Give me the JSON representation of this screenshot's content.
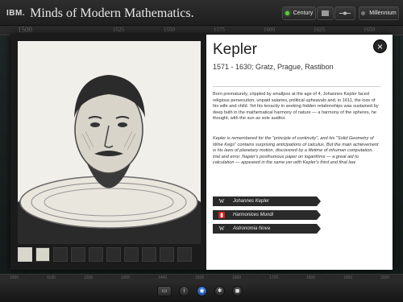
{
  "header": {
    "logo": "IBM.",
    "title": "Minds of Modern Mathematics.",
    "century_label": "Century",
    "millennium_label": "Millennium"
  },
  "timeline_top": [
    "1500",
    "1525",
    "1550",
    "1575",
    "1600",
    "1625",
    "1650"
  ],
  "timeline_bottom": [
    "1000",
    "1100",
    "1200",
    "1300",
    "1400",
    "1500",
    "1600",
    "1700",
    "1800",
    "1900",
    "2000"
  ],
  "detail": {
    "name": "Kepler",
    "dates": "1571 - 1630; Gratz, Prague, Rastibon",
    "bio": "Born prematurely, crippled by smallpox at the age of 4, Johannes Kepler faced religious persecution, unpaid salaries, political upheavals and, in 1611, the loss of his wife and child. Yet his tenacity in seeking hidden relationships was sustained by deep faith in the mathematical harmony of nature — a harmony of the spheres, he thought, with the sun as sole auditor.",
    "legacy": "Kepler is remembered for the \"principle of continuity\", and his \"Solid Geometry of Wine Kegs\" contains surprising anticipations of calculus. But the main achievement is his laws of planetary motion, discovered by a lifetime of inhuman computation, trial and error. Napier's posthumous paper on logarithms — a great aid to calculation — appeared in the same yer with Kepler's third and final law.",
    "close_label": "×",
    "links": [
      {
        "icon": "W",
        "label": "Johannes Kepler",
        "icon_color": "#2a2a2a"
      },
      {
        "icon": "▮",
        "label": "Harmonices Mundi",
        "icon_color": "#d21b1b"
      },
      {
        "icon": "W",
        "label": "Astronomia Nova",
        "icon_color": "#2a2a2a"
      }
    ]
  },
  "toolbar": {
    "btn1": "▭",
    "btn2": "i",
    "btn3": "◉",
    "btn4": "✱",
    "btn5": "◼"
  },
  "colors": {
    "accent_green": "#59d13a",
    "active_blue": "#3c7dd8",
    "link_red": "#d21b1b"
  }
}
